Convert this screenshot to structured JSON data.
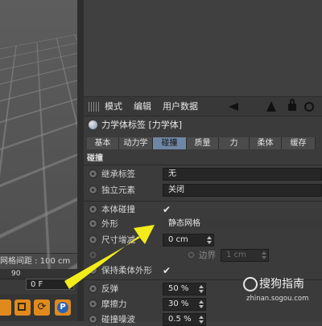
{
  "viewport": {
    "grid_spacing_label": "网格间距 : 100 cm"
  },
  "timeline": {
    "ruler_number": "90",
    "frame_value": "0 F"
  },
  "transport": {
    "icons": [
      "record-key-icon",
      "key-square-icon",
      "auto-key-icon",
      "parameter-key-icon"
    ],
    "p_label": "P"
  },
  "menubar": {
    "items": [
      "模式",
      "编辑",
      "用户数据"
    ],
    "icons": [
      "arrow-left-icon",
      "cursor-icon",
      "lock-icon",
      "link-icon"
    ]
  },
  "object": {
    "title": "力学体标签 [力学体]"
  },
  "tabs": [
    "基本",
    "动力学",
    "碰撞",
    "质量",
    "力",
    "柔体",
    "缓存"
  ],
  "active_tab": "碰撞",
  "section": {
    "title": "碰撞"
  },
  "params": {
    "inherit_tag": {
      "label": "继承标签",
      "value": "无"
    },
    "standalone": {
      "label": "独立元素",
      "value": "关闭"
    },
    "self_collision": {
      "label": "本体碰撞",
      "checked": "✔"
    },
    "shape": {
      "label": "外形",
      "value": "静态网格"
    },
    "size_increment": {
      "label": "尺寸增减",
      "value": "0 cm"
    },
    "margin": {
      "label": "边界",
      "value": "1 cm"
    },
    "keep_soft_shape": {
      "label": "保持柔体外形",
      "checked": "✔"
    },
    "bounce": {
      "label": "反弹",
      "value": "50 %"
    },
    "friction": {
      "label": "摩擦力",
      "value": "30 %"
    },
    "collision_noise": {
      "label": "碰撞噪波",
      "value": "0.5 %"
    }
  },
  "watermark": {
    "brand": "搜狗指南",
    "url": "zhinan.sogou.com"
  },
  "colors": {
    "accent_tab": "#6f87a6",
    "arrow": "#f2ec1a",
    "transport": "#e08a1e"
  }
}
